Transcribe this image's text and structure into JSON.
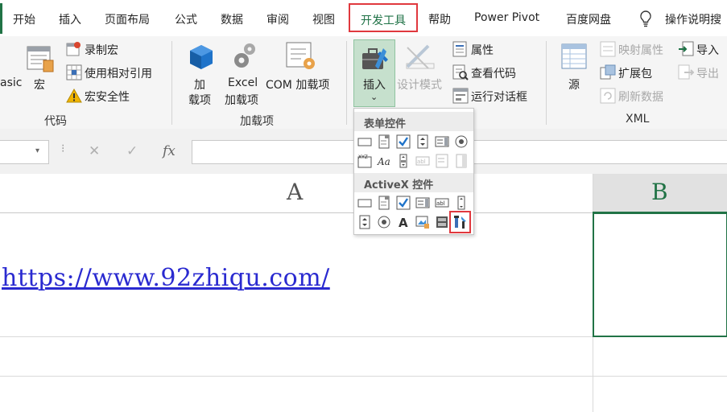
{
  "tabs": [
    "开始",
    "插入",
    "页面布局",
    "公式",
    "数据",
    "审阅",
    "视图",
    "开发工具",
    "帮助",
    "Power Pivot",
    "百度网盘",
    "操作说明搜"
  ],
  "active_tab": "开发工具",
  "ribbon": {
    "code_group": {
      "label": "代码",
      "basic": "asic",
      "macro": "宏",
      "record_macro": "录制宏",
      "relative_ref": "使用相对引用",
      "macro_security": "宏安全性"
    },
    "addins_group": {
      "label": "加载项",
      "addins_line1": "加",
      "addins_line2": "载项",
      "excel_line1": "Excel",
      "excel_line2": "加载项",
      "com_addins": "COM 加载项"
    },
    "controls_group": {
      "insert": "插入",
      "insert_arrow": "⌄",
      "design_mode": "设计模式",
      "properties": "属性",
      "view_code": "查看代码",
      "run_dialog": "运行对话框"
    },
    "xml_group": {
      "label": "XML",
      "source": "源",
      "map_props": "映射属性",
      "expansion": "扩展包",
      "refresh": "刷新数据",
      "import": "导入",
      "export": "导出"
    }
  },
  "dropdown": {
    "form_controls_title": "表单控件",
    "activex_title": "ActiveX 控件"
  },
  "formula_bar": {
    "cancel": "✕",
    "enter": "✓",
    "fx": "fx",
    "value": ""
  },
  "grid": {
    "col_a": "A",
    "col_b": "B",
    "link_text": "https://www.92zhiqu.com/"
  },
  "colors": {
    "accent": "#217346",
    "highlight": "#e0383e",
    "link": "#2a2ad0"
  }
}
